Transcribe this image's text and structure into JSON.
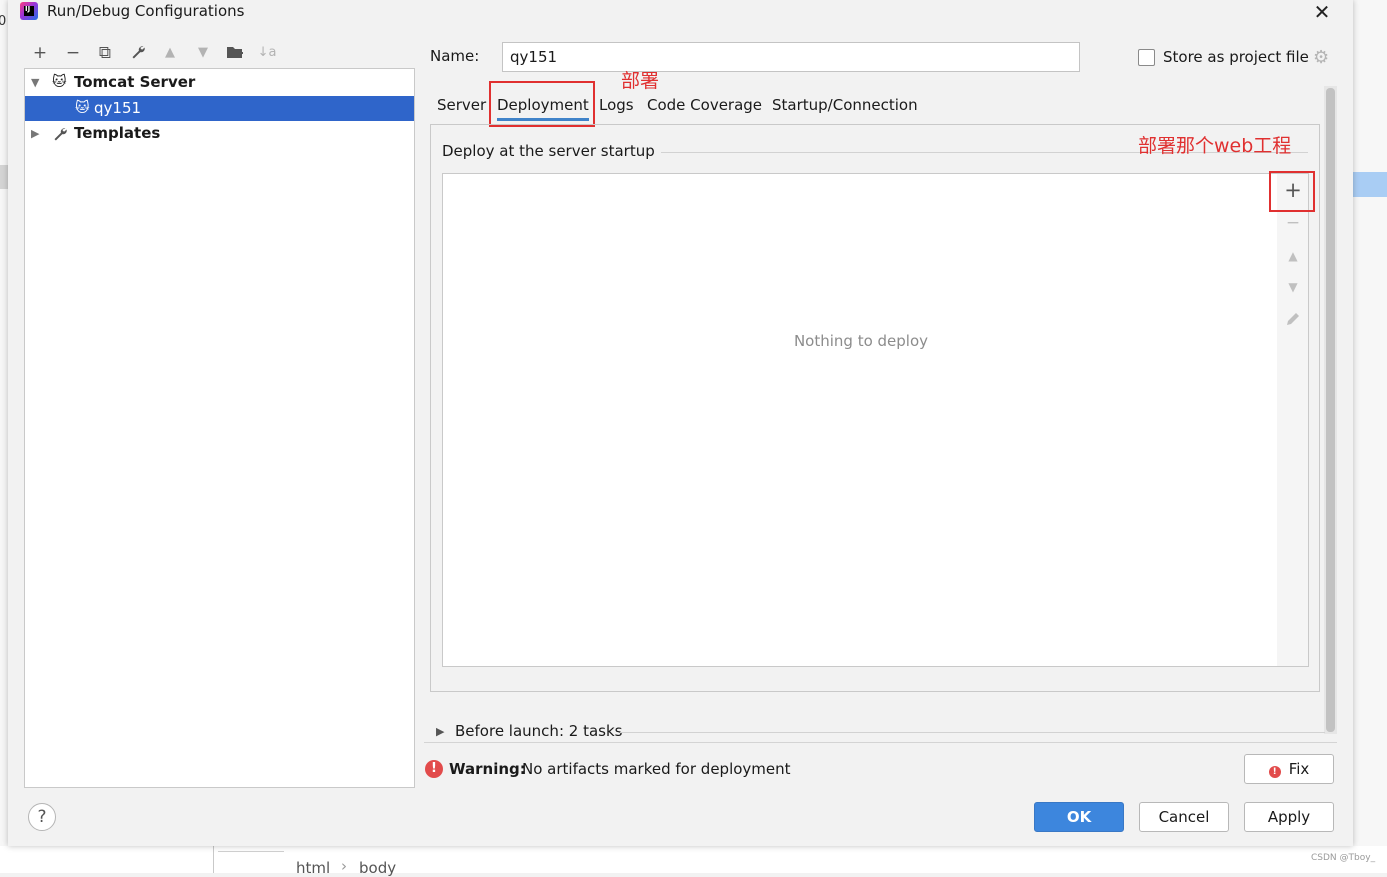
{
  "window": {
    "title": "Run/Debug Configurations"
  },
  "toolbar": {
    "add": "+",
    "remove": "−",
    "copy": "⧉",
    "edit": "🔧",
    "up": "▲",
    "down": "▼",
    "folder": "📁",
    "sort": "↓a"
  },
  "tree": {
    "tomcat_server": "Tomcat Server",
    "config_item": "qy151",
    "templates": "Templates"
  },
  "form": {
    "name_label": "Name:",
    "name_value": "qy151",
    "store_label": "Store as project file"
  },
  "tabs": [
    "Server",
    "Deployment",
    "Logs",
    "Code Coverage",
    "Startup/Connection"
  ],
  "annotations": {
    "deploy_tab": "部署",
    "deploy_web": "部署那个web工程"
  },
  "deployment": {
    "section_title": "Deploy at the server startup",
    "empty": "Nothing to deploy"
  },
  "before_launch": "Before launch: 2 tasks",
  "warning": {
    "label": "Warning:",
    "text": "No artifacts marked for deployment"
  },
  "buttons": {
    "fix": "Fix",
    "ok": "OK",
    "cancel": "Cancel",
    "apply": "Apply",
    "help": "?"
  },
  "background": {
    "crumb_html": "html",
    "crumb_body": "body",
    "watermark": "CSDN @Tboy_"
  },
  "icons": [
    "app-icon",
    "close-icon",
    "add-icon",
    "remove-icon",
    "copy-icon",
    "wrench-icon",
    "arrow-up-icon",
    "arrow-down-icon",
    "folder-add-icon",
    "sort-icon",
    "tomcat-icon",
    "wrench-icon",
    "gear-icon",
    "plus-icon",
    "minus-icon",
    "move-up-icon",
    "move-down-icon",
    "pencil-icon",
    "error-icon"
  ],
  "colors": {
    "selection": "#2f65ca",
    "primary_button": "#3d86dd",
    "annotation": "#e03030",
    "tab_underline": "#4083c9"
  }
}
